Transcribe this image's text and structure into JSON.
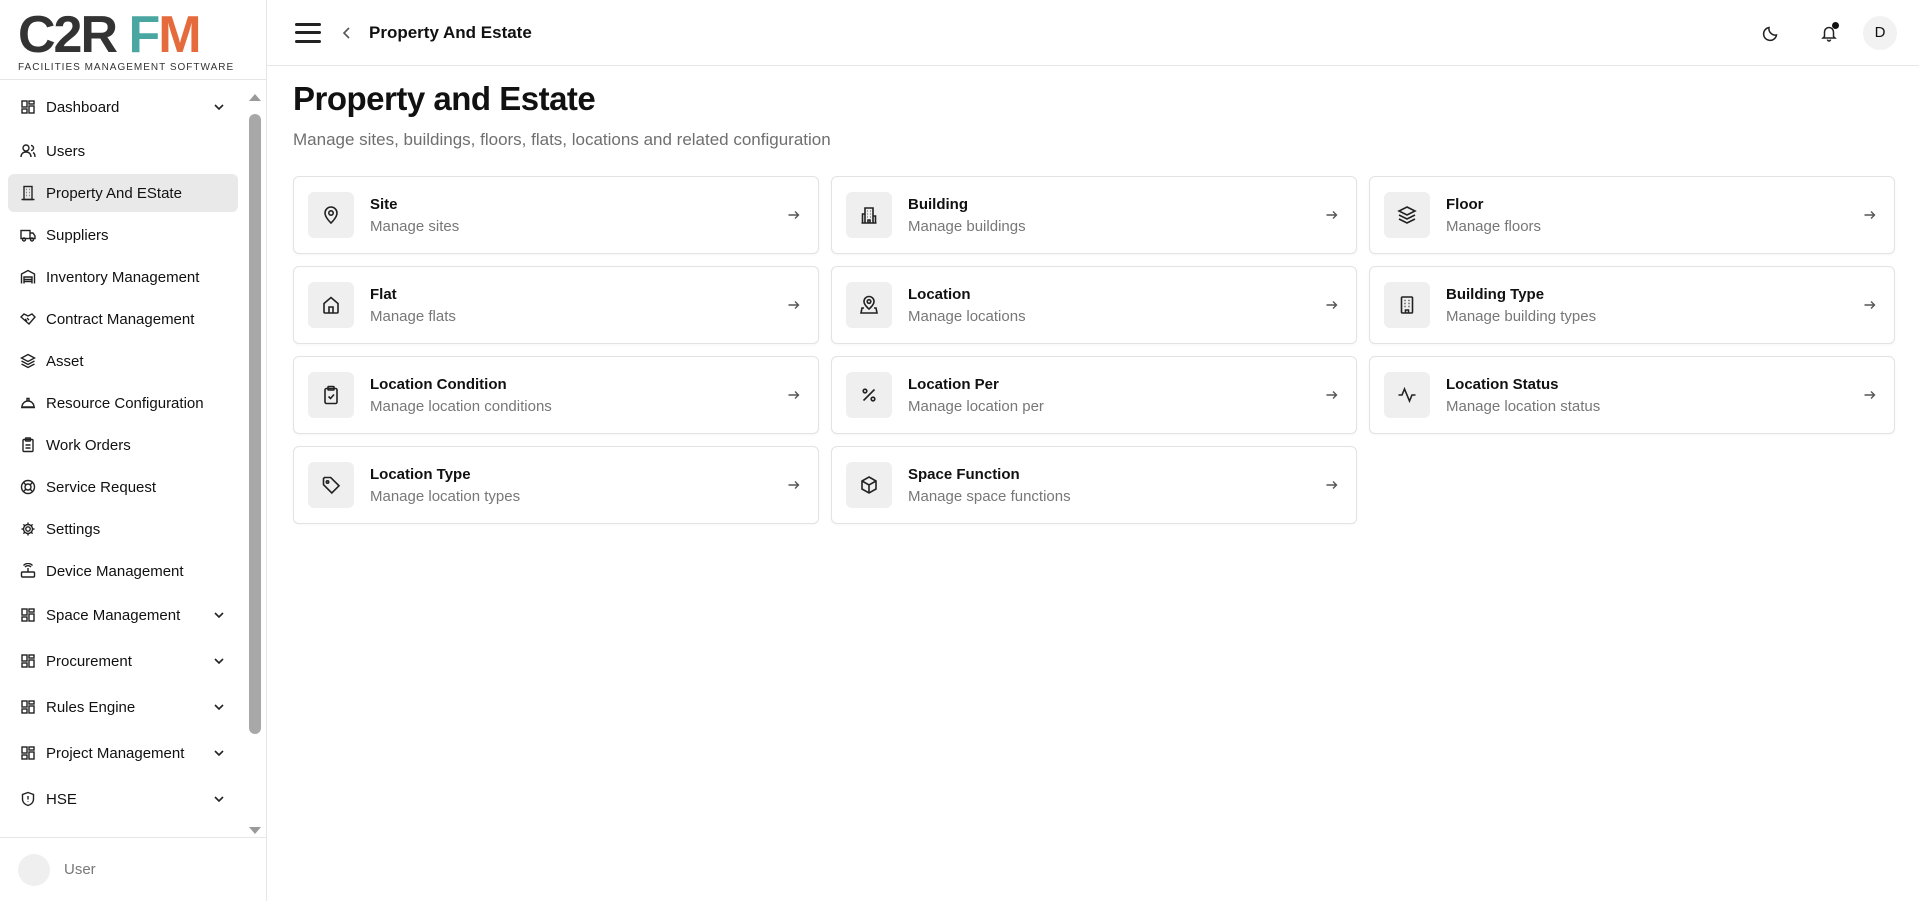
{
  "logo": {
    "text_c2r": "C2R",
    "text_f": "F",
    "text_m": "M",
    "tagline": "FACILITIES MANAGEMENT SOFTWARE"
  },
  "sidebar": {
    "items": [
      {
        "label": "Dashboard",
        "icon": "grid-icon",
        "expandable": true
      },
      {
        "label": "Users",
        "icon": "users-icon",
        "expandable": false
      },
      {
        "label": "Property And EState",
        "icon": "building-icon",
        "expandable": false,
        "active": true
      },
      {
        "label": "Suppliers",
        "icon": "truck-icon",
        "expandable": false
      },
      {
        "label": "Inventory Management",
        "icon": "warehouse-icon",
        "expandable": false
      },
      {
        "label": "Contract Management",
        "icon": "handshake-icon",
        "expandable": false
      },
      {
        "label": "Asset",
        "icon": "layers-icon",
        "expandable": false
      },
      {
        "label": "Resource Configuration",
        "icon": "helmet-icon",
        "expandable": false
      },
      {
        "label": "Work Orders",
        "icon": "clipboard-icon",
        "expandable": false
      },
      {
        "label": "Service Request",
        "icon": "lifebuoy-icon",
        "expandable": false
      },
      {
        "label": "Settings",
        "icon": "gear-icon",
        "expandable": false
      },
      {
        "label": "Device Management",
        "icon": "router-icon",
        "expandable": false
      },
      {
        "label": "Space Management",
        "icon": "grid-icon",
        "expandable": true
      },
      {
        "label": "Procurement",
        "icon": "grid-icon",
        "expandable": true
      },
      {
        "label": "Rules Engine",
        "icon": "grid-icon",
        "expandable": true
      },
      {
        "label": "Project Management",
        "icon": "grid-icon",
        "expandable": true
      },
      {
        "label": "HSE",
        "icon": "shield-icon",
        "expandable": true
      }
    ],
    "user_label": "User"
  },
  "topbar": {
    "breadcrumb": "Property And Estate",
    "avatar_initial": "D"
  },
  "page": {
    "title": "Property and Estate",
    "subtitle": "Manage sites, buildings, floors, flats, locations and related configuration"
  },
  "cards": [
    {
      "title": "Site",
      "desc": "Manage sites",
      "icon": "map-pin-icon"
    },
    {
      "title": "Building",
      "desc": "Manage buildings",
      "icon": "building-icon"
    },
    {
      "title": "Floor",
      "desc": "Manage floors",
      "icon": "layers-icon"
    },
    {
      "title": "Flat",
      "desc": "Manage flats",
      "icon": "home-icon"
    },
    {
      "title": "Location",
      "desc": "Manage locations",
      "icon": "map-pin-person-icon"
    },
    {
      "title": "Building Type",
      "desc": "Manage building types",
      "icon": "office-icon"
    },
    {
      "title": "Location Condition",
      "desc": "Manage location conditions",
      "icon": "clipboard-check-icon"
    },
    {
      "title": "Location Per",
      "desc": "Manage location per",
      "icon": "percent-icon"
    },
    {
      "title": "Location Status",
      "desc": "Manage location status",
      "icon": "activity-icon"
    },
    {
      "title": "Location Type",
      "desc": "Manage location types",
      "icon": "tag-icon"
    },
    {
      "title": "Space Function",
      "desc": "Manage space functions",
      "icon": "box-icon"
    }
  ],
  "colors": {
    "logo_dark": "#333333",
    "logo_teal": "#4aa6a0",
    "logo_orange": "#e56a3c",
    "active_bg": "#e9e9e9",
    "card_icon_bg": "#efefef"
  }
}
